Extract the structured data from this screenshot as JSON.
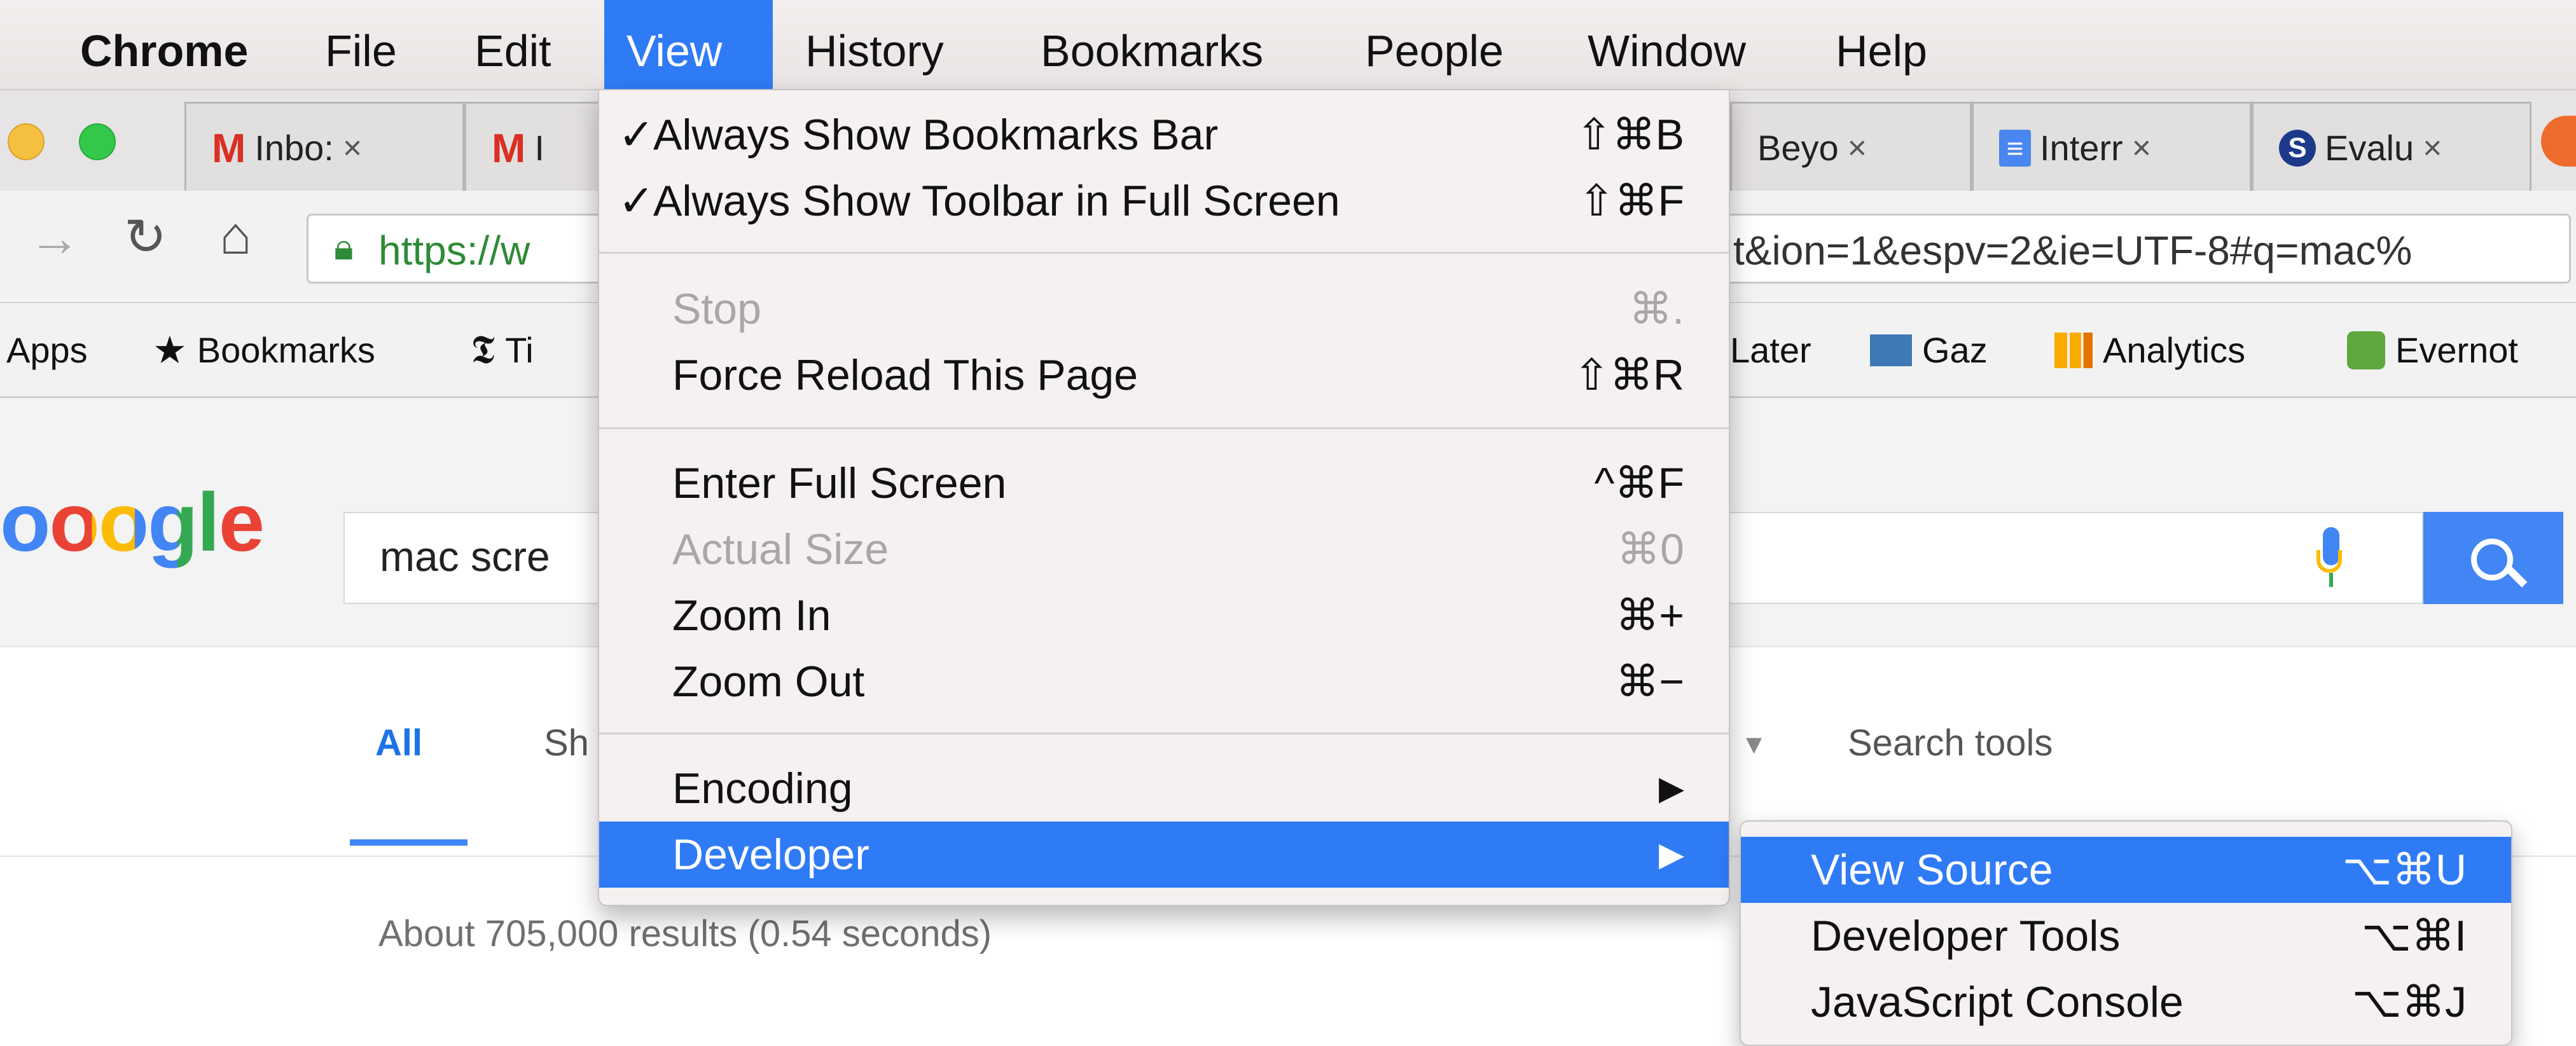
{
  "menubar": {
    "items": [
      "Chrome",
      "File",
      "Edit",
      "View",
      "History",
      "Bookmarks",
      "People",
      "Window",
      "Help"
    ]
  },
  "tabs": [
    {
      "icon": "gmail-icon",
      "glyph": "M",
      "label": "Inbo:",
      "close": "×"
    },
    {
      "icon": "gmail-icon",
      "glyph": "M",
      "label": "I",
      "close": "×"
    },
    {
      "icon": "",
      "glyph": "",
      "label": "Beyo",
      "close": "×"
    },
    {
      "icon": "docs-icon",
      "glyph": "≡",
      "label": "Interr",
      "close": "×"
    },
    {
      "icon": "s-logo-icon",
      "glyph": "S",
      "label": "Evalu",
      "close": "×"
    }
  ],
  "toolbar": {
    "url_left": "https://w",
    "url_right": "t&ion=1&espv=2&ie=UTF-8#q=mac%"
  },
  "bookmarks": [
    {
      "label": "Apps",
      "icon": ""
    },
    {
      "label": "Bookmarks",
      "icon": "★"
    },
    {
      "label": "Ti",
      "icon": "𝕿"
    },
    {
      "label": "Later",
      "icon": ""
    },
    {
      "label": "Gaz",
      "icon": ""
    },
    {
      "label": "Analytics",
      "icon": ""
    },
    {
      "label": "Evernot",
      "icon": ""
    }
  ],
  "google": {
    "logo": "oogle",
    "query": "mac scre",
    "nav": {
      "all": "All",
      "sh": "Sh",
      "search_tools": "Search tools"
    },
    "results_info": "About 705,000 results (0.54 seconds)"
  },
  "view_menu": [
    {
      "check": "✓",
      "label": "Always Show Bookmarks Bar",
      "shortcut": "⇧⌘B",
      "state": "normal"
    },
    {
      "check": "✓",
      "label": "Always Show Toolbar in Full Screen",
      "shortcut": "⇧⌘F",
      "state": "normal"
    },
    {
      "check": "",
      "label": "Stop",
      "shortcut": "⌘.",
      "state": "disabled"
    },
    {
      "check": "",
      "label": "Force Reload This Page",
      "shortcut": "⇧⌘R",
      "state": "normal"
    },
    {
      "check": "",
      "label": "Enter Full Screen",
      "shortcut": "^⌘F",
      "state": "normal"
    },
    {
      "check": "",
      "label": "Actual Size",
      "shortcut": "⌘0",
      "state": "disabled"
    },
    {
      "check": "",
      "label": "Zoom In",
      "shortcut": "⌘+",
      "state": "normal"
    },
    {
      "check": "",
      "label": "Zoom Out",
      "shortcut": "⌘−",
      "state": "normal"
    },
    {
      "check": "",
      "label": "Encoding",
      "shortcut": "▶",
      "state": "normal"
    },
    {
      "check": "",
      "label": "Developer",
      "shortcut": "▶",
      "state": "active"
    }
  ],
  "developer_menu": [
    {
      "label": "View Source",
      "shortcut": "⌥⌘U",
      "state": "active"
    },
    {
      "label": "Developer Tools",
      "shortcut": "⌥⌘I",
      "state": "normal"
    },
    {
      "label": "JavaScript Console",
      "shortcut": "⌥⌘J",
      "state": "normal"
    }
  ],
  "colors": {
    "accent": "#2f7bf6",
    "google_blue": "#4285f4"
  }
}
